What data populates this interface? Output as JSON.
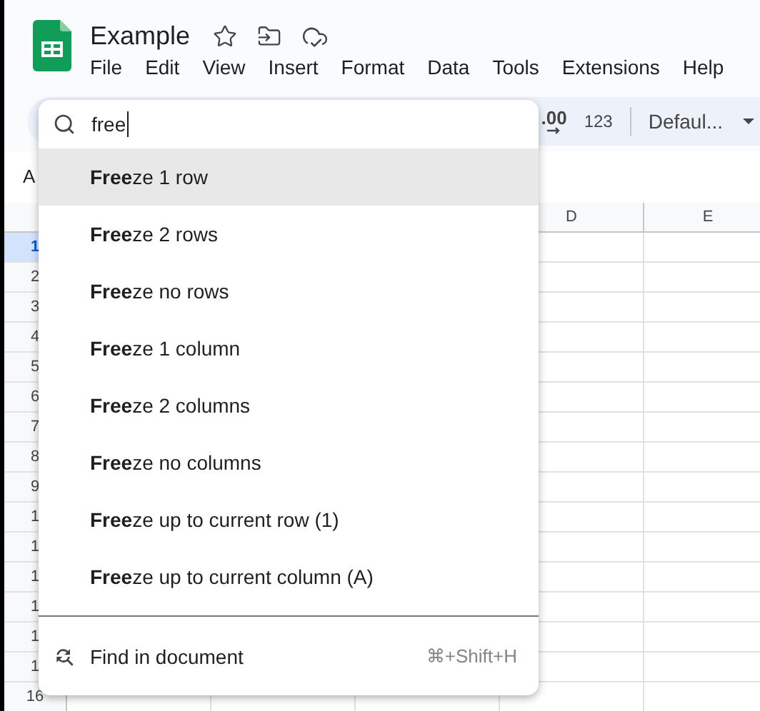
{
  "document": {
    "title": "Example"
  },
  "menu": [
    "File",
    "Edit",
    "View",
    "Insert",
    "Format",
    "Data",
    "Tools",
    "Extensions",
    "Help"
  ],
  "toolbar": {
    "decimal_label": ".00",
    "number_format": "123",
    "font": "Defaul..."
  },
  "name_box": "A",
  "columns": [
    "",
    "",
    "",
    "D",
    "E"
  ],
  "rows": [
    {
      "label": "1",
      "selected": true
    },
    {
      "label": "2",
      "selected": false
    },
    {
      "label": "3",
      "selected": false
    },
    {
      "label": "4",
      "selected": false
    },
    {
      "label": "5",
      "selected": false
    },
    {
      "label": "6",
      "selected": false
    },
    {
      "label": "7",
      "selected": false
    },
    {
      "label": "8",
      "selected": false
    },
    {
      "label": "9",
      "selected": false
    },
    {
      "label": "1",
      "selected": false
    },
    {
      "label": "1",
      "selected": false
    },
    {
      "label": "1",
      "selected": false
    },
    {
      "label": "1",
      "selected": false
    },
    {
      "label": "1",
      "selected": false
    },
    {
      "label": "1",
      "selected": false
    },
    {
      "label": "16",
      "selected": false
    }
  ],
  "search": {
    "value": "free"
  },
  "results": [
    {
      "label": "**Free**ze 1 row",
      "selected": true
    },
    {
      "label": "**Free**ze 2 rows",
      "selected": false
    },
    {
      "label": "**Free**ze no rows",
      "selected": false
    },
    {
      "label": "**Free**ze 1 column",
      "selected": false
    },
    {
      "label": "**Free**ze 2 columns",
      "selected": false
    },
    {
      "label": "**Free**ze no columns",
      "selected": false
    },
    {
      "label": "**Free**ze up to current row (1)",
      "selected": false
    },
    {
      "label": "**Free**ze up to current column (A)",
      "selected": false
    }
  ],
  "find": {
    "label": "Find in document",
    "shortcut": "⌘+Shift+H"
  }
}
